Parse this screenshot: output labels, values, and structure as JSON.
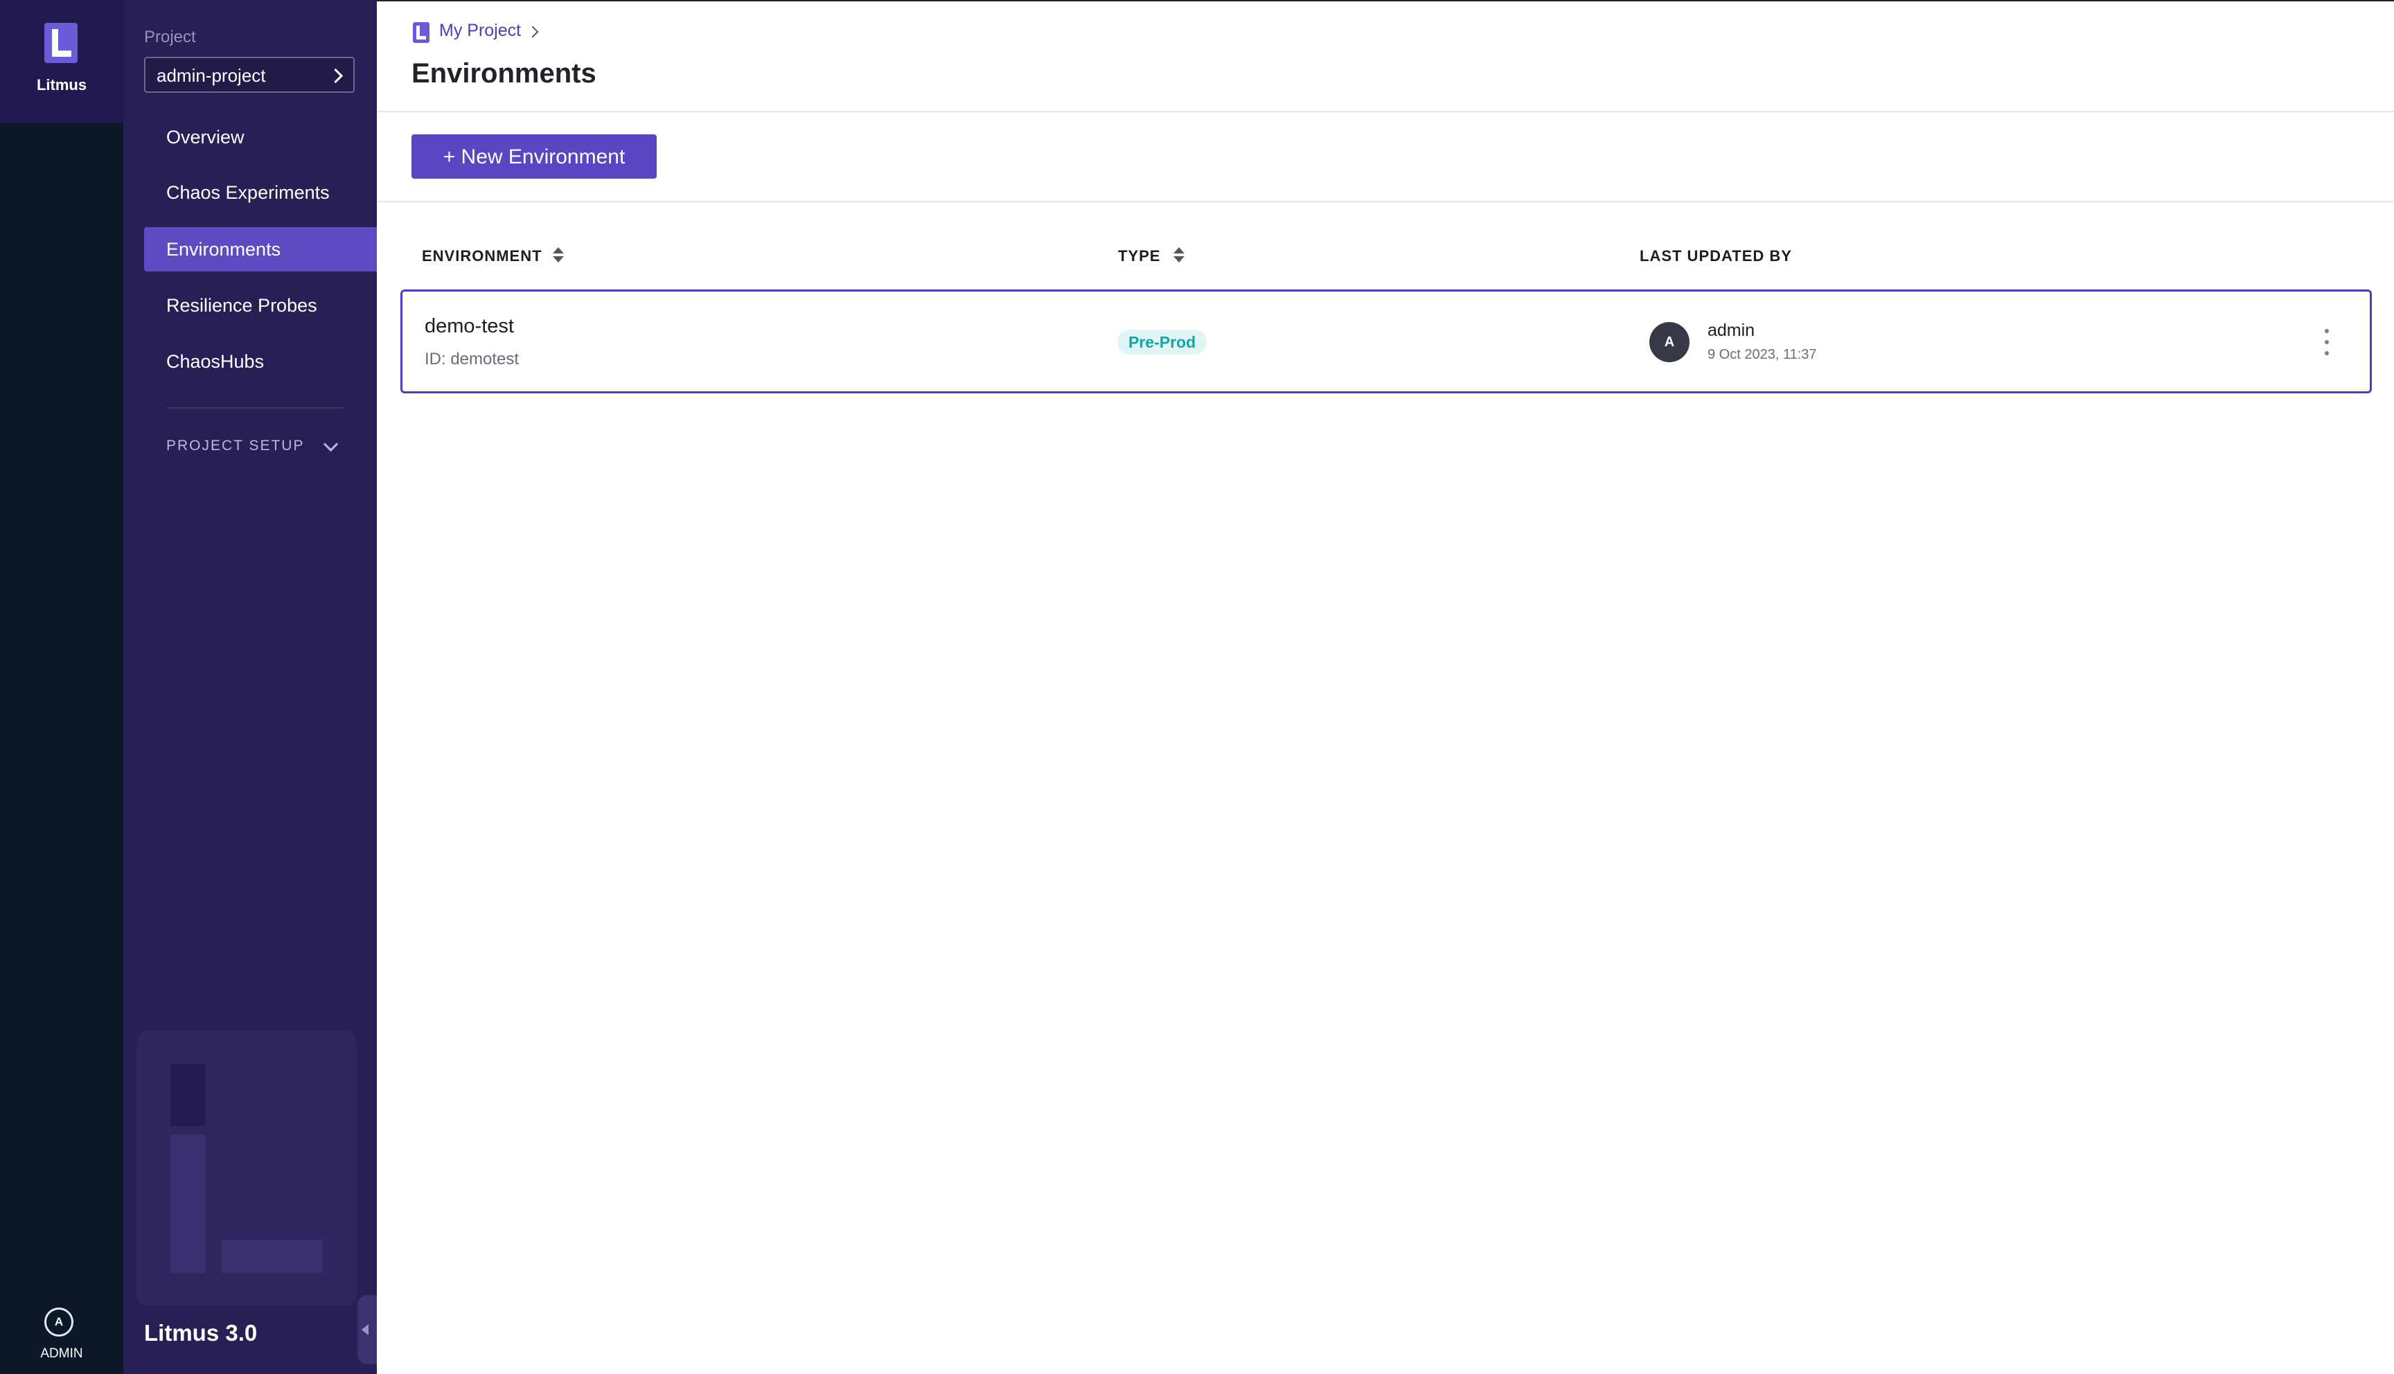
{
  "rail": {
    "app_name": "Litmus",
    "user_initial": "A",
    "user_label": "ADMIN"
  },
  "sidebar": {
    "project_label": "Project",
    "project_name": "admin-project",
    "items": [
      {
        "label": "Overview",
        "active": false
      },
      {
        "label": "Chaos Experiments",
        "active": false
      },
      {
        "label": "Environments",
        "active": true
      },
      {
        "label": "Resilience Probes",
        "active": false
      },
      {
        "label": "ChaosHubs",
        "active": false
      }
    ],
    "project_setup_label": "PROJECT SETUP",
    "version": "Litmus 3.0"
  },
  "header": {
    "breadcrumb": "My Project",
    "title": "Environments"
  },
  "toolbar": {
    "new_environment_label": "+ New Environment"
  },
  "table": {
    "columns": [
      "ENVIRONMENT",
      "TYPE",
      "LAST UPDATED BY"
    ],
    "rows": [
      {
        "name": "demo-test",
        "id_text": "ID: demotest",
        "type": "Pre-Prod",
        "user_initial": "A",
        "user": "admin",
        "updated": "9 Oct 2023, 11:37"
      }
    ]
  },
  "colors": {
    "accent": "#5b45c2",
    "sidebar_bg": "#2a1f55",
    "rail_bg": "#0b1827",
    "badge_text": "#16a4aa",
    "badge_bg": "#dff5f6"
  }
}
